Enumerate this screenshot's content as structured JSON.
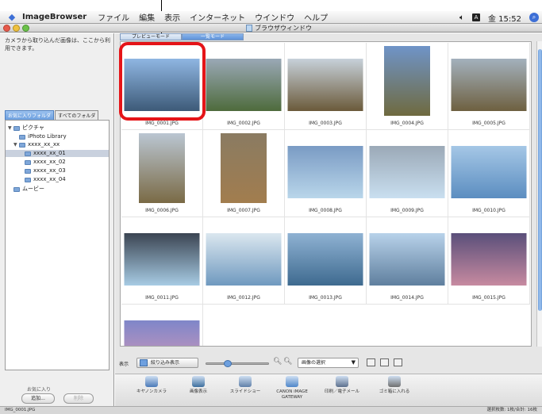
{
  "menubar": {
    "apple_icon": "apple-icon",
    "app_name": "ImageBrowser",
    "menus": [
      "ファイル",
      "編集",
      "表示",
      "インターネット",
      "ウインドウ",
      "ヘルプ"
    ],
    "clock": "金 15:52",
    "input_badge": "A"
  },
  "window": {
    "title": "ブラウザウィンドウ"
  },
  "left": {
    "intro_text": "カメラから取り込んだ画像は、ここから利用できます。",
    "tabs": [
      "お気に入りフォルダ",
      "すべてのフォルダ"
    ],
    "tree": [
      {
        "label": "ピクチャ",
        "disc": "▼"
      },
      {
        "label": "iPhoto Library",
        "disc": ""
      },
      {
        "label": "xxxx_xx_xx",
        "disc": "▼"
      },
      {
        "label": "xxxx_xx_01",
        "disc": ""
      },
      {
        "label": "xxxx_xx_02",
        "disc": ""
      },
      {
        "label": "xxxx_xx_03",
        "disc": ""
      },
      {
        "label": "xxxx_xx_04",
        "disc": ""
      },
      {
        "label": "ムービー",
        "disc": ""
      }
    ],
    "favorites_label": "お気に入り",
    "add_button": "追加...",
    "remove_button": "削除"
  },
  "main": {
    "view_tabs": [
      "プレビューモード",
      "一覧モード"
    ],
    "images": [
      {
        "name": "IMG_0001.JPG",
        "c1": "#8fb6e2",
        "c2": "#3d5a78"
      },
      {
        "name": "IMG_0002.JPG",
        "c1": "#9aa8b6",
        "c2": "#4e6b3c"
      },
      {
        "name": "IMG_0003.JPG",
        "c1": "#c7d1da",
        "c2": "#6b5a3a"
      },
      {
        "name": "IMG_0004.JPG",
        "c1": "#6f94c8",
        "c2": "#6f6a3f"
      },
      {
        "name": "IMG_0005.JPG",
        "c1": "#a3b1bd",
        "c2": "#6e6040"
      },
      {
        "name": "IMG_0006.JPG",
        "c1": "#bac6d2",
        "c2": "#7a6a45"
      },
      {
        "name": "IMG_0007.JPG",
        "c1": "#8a7b62",
        "c2": "#a27d4e"
      },
      {
        "name": "IMG_0008.JPG",
        "c1": "#7a9bc4",
        "c2": "#b9d6ea"
      },
      {
        "name": "IMG_0009.JPG",
        "c1": "#9ba9b7",
        "c2": "#c9dff0"
      },
      {
        "name": "IMG_0010.JPG",
        "c1": "#a5c7e6",
        "c2": "#5b8dc0"
      },
      {
        "name": "IMG_0011.JPG",
        "c1": "#3b4552",
        "c2": "#a7cbe4"
      },
      {
        "name": "IMG_0012.JPG",
        "c1": "#dbe7ef",
        "c2": "#6f99bf"
      },
      {
        "name": "IMG_0013.JPG",
        "c1": "#8fb2d3",
        "c2": "#3e6a8f"
      },
      {
        "name": "IMG_0014.JPG",
        "c1": "#b8d2ea",
        "c2": "#5f7f9e"
      },
      {
        "name": "IMG_0015.JPG",
        "c1": "#5a4f7a",
        "c2": "#c78aa0"
      },
      {
        "name": "",
        "c1": "#7f86c9",
        "c2": "#d79ab8"
      }
    ]
  },
  "controls": {
    "display_label": "表示",
    "filter_button": "絞り込み表示",
    "select_dropdown": "画像の選択",
    "zoom_out_icon": "zoom-out-icon",
    "zoom_in_icon": "zoom-in-icon"
  },
  "toolbar": {
    "items": [
      {
        "label": "キヤノンカメラ",
        "color": "#4a79b8"
      },
      {
        "label": "画像表示",
        "color": "#3d6f9e"
      },
      {
        "label": "スライドショー",
        "color": "#5f7fa8"
      },
      {
        "label": "CANON iMAGE GATEWAY",
        "color": "#4e86c9"
      },
      {
        "label": "印刷／電子メール",
        "color": "#5c6f8c"
      },
      {
        "label": "ゴミ箱に入れる",
        "color": "#6f6f6f"
      }
    ]
  },
  "status": {
    "left": "IMG_0001.JPG",
    "right": "選択枚数: 1枚/合計: 16枚"
  },
  "accent_color": "#e51418"
}
